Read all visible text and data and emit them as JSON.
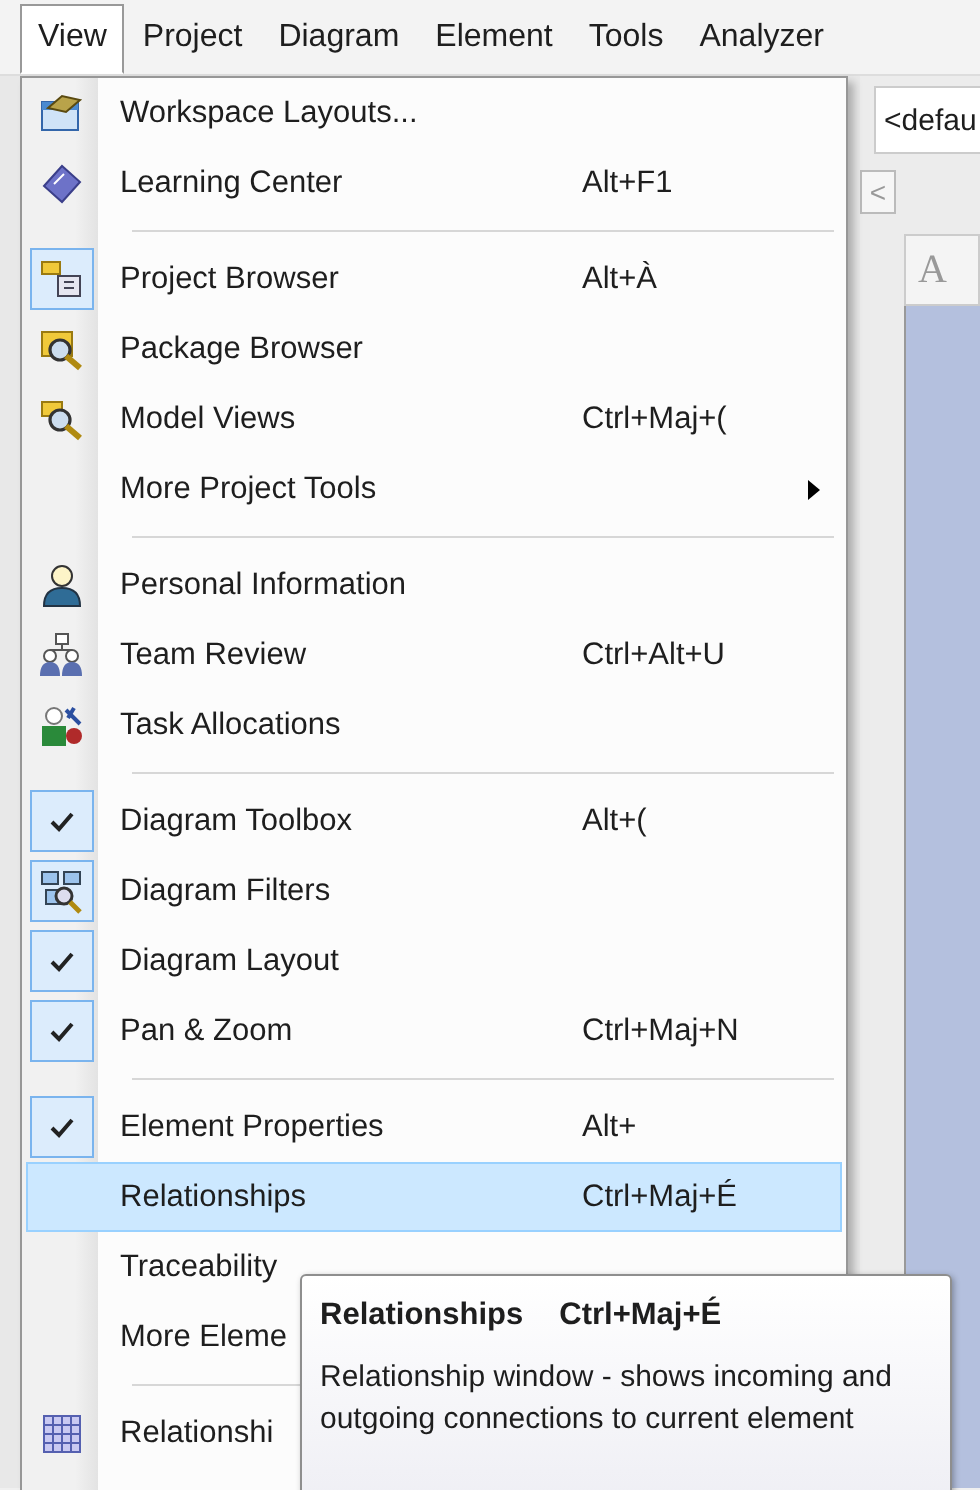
{
  "menubar": [
    {
      "label": "View",
      "selected": true
    },
    {
      "label": "Project",
      "selected": false
    },
    {
      "label": "Diagram",
      "selected": false
    },
    {
      "label": "Element",
      "selected": false
    },
    {
      "label": "Tools",
      "selected": false
    },
    {
      "label": "Analyzer",
      "selected": false
    }
  ],
  "toolbar": {
    "combo_value": "<defau",
    "scroll_button": "<",
    "font_button": "A"
  },
  "menu_groups": [
    [
      {
        "label": "Workspace Layouts...",
        "checked": false,
        "selected": false
      },
      {
        "label": "Learning Center",
        "shortcut": "Alt+F1",
        "checked": false,
        "selected": false
      }
    ],
    [
      {
        "label": "Project Browser",
        "shortcut": "Alt+À",
        "checked": true,
        "selected": false
      },
      {
        "label": "Package Browser",
        "checked": false,
        "selected": false
      },
      {
        "label": "Model Views",
        "shortcut": "Ctrl+Maj+(",
        "checked": false,
        "selected": false
      },
      {
        "label": "More Project Tools",
        "submenu": true,
        "checked": false,
        "selected": false
      }
    ],
    [
      {
        "label": "Personal Information",
        "checked": false,
        "selected": false
      },
      {
        "label": "Team Review",
        "shortcut": "Ctrl+Alt+U",
        "checked": false,
        "selected": false
      },
      {
        "label": "Task Allocations",
        "checked": false,
        "selected": false
      }
    ],
    [
      {
        "label": "Diagram Toolbox",
        "shortcut": "Alt+(",
        "checked": true,
        "selected": false
      },
      {
        "label": "Diagram Filters",
        "checked": true,
        "selected": false
      },
      {
        "label": "Diagram Layout",
        "checked": true,
        "selected": false
      },
      {
        "label": "Pan & Zoom",
        "shortcut": "Ctrl+Maj+N",
        "checked": true,
        "selected": false
      }
    ],
    [
      {
        "label": "Element Properties",
        "shortcut": "Alt+",
        "checked": true,
        "selected": false
      },
      {
        "label": "Relationships",
        "shortcut": "Ctrl+Maj+É",
        "checked": false,
        "selected": true
      },
      {
        "label": "Traceability",
        "checked": false,
        "selected": false
      },
      {
        "label": "More Eleme",
        "checked": false,
        "selected": false
      }
    ],
    [
      {
        "label": "Relationshi",
        "checked": false,
        "selected": false
      }
    ]
  ],
  "tooltip": {
    "title": "Relationships",
    "shortcut": "Ctrl+Maj+É",
    "description": "Relationship window - shows incoming and outgoing connections to current element"
  }
}
